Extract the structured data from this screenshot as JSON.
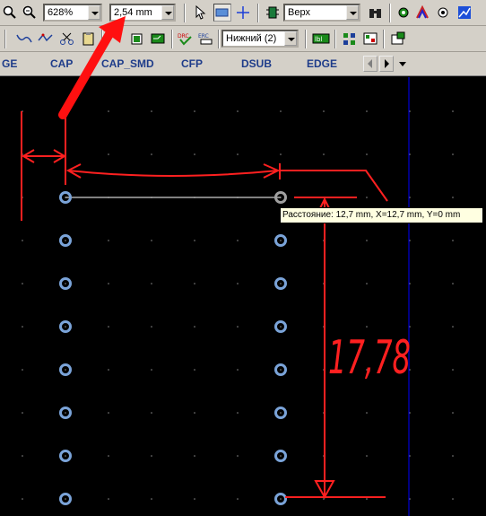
{
  "toolbar1": {
    "zoom_value": "628%",
    "grid_value": "2,54 mm",
    "layer_value": "Верх"
  },
  "toolbar2": {
    "layer_select": "Нижний (2)"
  },
  "tabs": [
    "GE",
    "CAP",
    "CAP_SMD",
    "CFP",
    "DSUB",
    "EDGE"
  ],
  "tooltip": {
    "text": "Расстояние: 12,7 mm,  X=12,7 mm,  Y=0 mm"
  },
  "annotation": {
    "label": "17,78"
  },
  "colors": {
    "background": "#000000",
    "pad": "#7aa3d8",
    "annotation": "#ff0000",
    "guide": "#0000ff"
  }
}
